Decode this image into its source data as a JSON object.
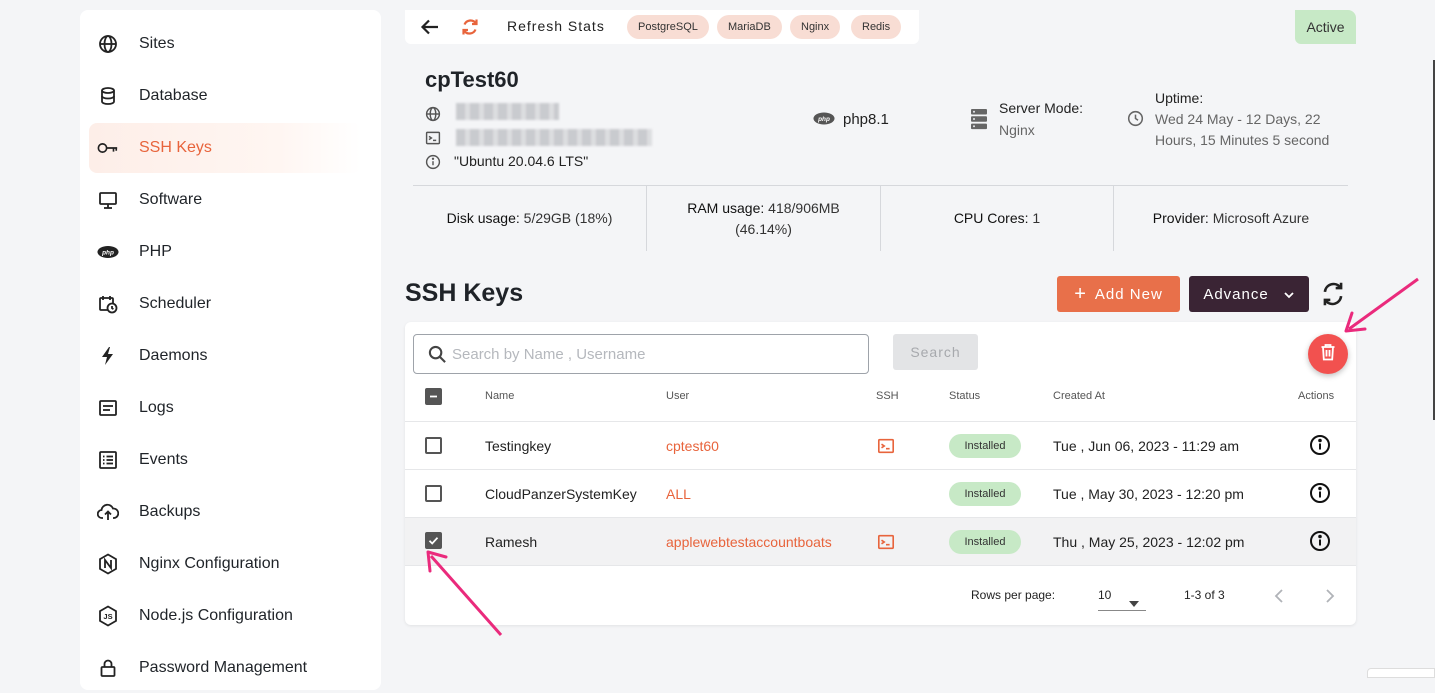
{
  "sidebar": {
    "items": [
      {
        "label": "Sites",
        "icon": "globe-icon",
        "active": false
      },
      {
        "label": "Database",
        "icon": "database-icon",
        "active": false
      },
      {
        "label": "SSH Keys",
        "icon": "key-icon",
        "active": true
      },
      {
        "label": "Software",
        "icon": "monitor-icon",
        "active": false
      },
      {
        "label": "PHP",
        "icon": "php-icon",
        "active": false
      },
      {
        "label": "Scheduler",
        "icon": "calendar-clock-icon",
        "active": false
      },
      {
        "label": "Daemons",
        "icon": "bolt-icon",
        "active": false
      },
      {
        "label": "Logs",
        "icon": "logs-icon",
        "active": false
      },
      {
        "label": "Events",
        "icon": "list-icon",
        "active": false
      },
      {
        "label": "Backups",
        "icon": "cloud-upload-icon",
        "active": false
      },
      {
        "label": "Nginx Configuration",
        "icon": "nginx-icon",
        "active": false
      },
      {
        "label": "Node.js Configuration",
        "icon": "nodejs-icon",
        "active": false
      },
      {
        "label": "Password Management",
        "icon": "lock-icon",
        "active": false
      }
    ]
  },
  "topbar": {
    "refresh_label": "Refresh Stats",
    "services": [
      "PostgreSQL",
      "MariaDB",
      "Nginx",
      "Redis"
    ]
  },
  "server": {
    "status": "Active",
    "name": "cpTest60",
    "os": "\"Ubuntu 20.04.6 LTS\"",
    "php_version": "php8.1",
    "server_mode_label": "Server Mode:",
    "server_mode": "Nginx",
    "uptime_label": "Uptime:",
    "uptime": "Wed 24 May - 12 Days, 22 Hours, 15 Minutes 5 second",
    "stats": {
      "disk_label": "Disk usage:",
      "disk_value": "5/29GB (18%)",
      "ram_label": "RAM usage:",
      "ram_value": "418/906MB",
      "ram_percent": "(46.14%)",
      "cpu_label": "CPU Cores:",
      "cpu_value": "1",
      "provider_label": "Provider:",
      "provider_value": "Microsoft Azure"
    }
  },
  "page": {
    "title": "SSH Keys",
    "add_new_label": "Add New",
    "advance_label": "Advance"
  },
  "search": {
    "placeholder": "Search by Name , Username",
    "button_label": "Search"
  },
  "table": {
    "headers": {
      "name": "Name",
      "user": "User",
      "ssh": "SSH",
      "status": "Status",
      "created": "Created At",
      "actions": "Actions"
    },
    "rows": [
      {
        "name": "Testingkey",
        "user": "cptest60",
        "has_ssh": true,
        "status": "Installed",
        "created": "Tue , Jun 06, 2023 - 11:29 am",
        "selected": false
      },
      {
        "name": "CloudPanzerSystemKey",
        "user": "ALL",
        "has_ssh": false,
        "status": "Installed",
        "created": "Tue , May 30, 2023 - 12:20 pm",
        "selected": false
      },
      {
        "name": "Ramesh",
        "user": "applewebtestaccountboats",
        "has_ssh": true,
        "status": "Installed",
        "created": "Thu , May 25, 2023 - 12:02 pm",
        "selected": true
      }
    ]
  },
  "pagination": {
    "rows_per_page_label": "Rows per page:",
    "rows_per_page": "10",
    "range": "1-3 of 3"
  },
  "colors": {
    "accent": "#e8643c",
    "add_button": "#e8704a",
    "advance_button": "#3a2434",
    "installed_badge": "#c7e9c6",
    "delete_fab": "#f2514f",
    "annotation_arrow": "#ea2a7c"
  }
}
